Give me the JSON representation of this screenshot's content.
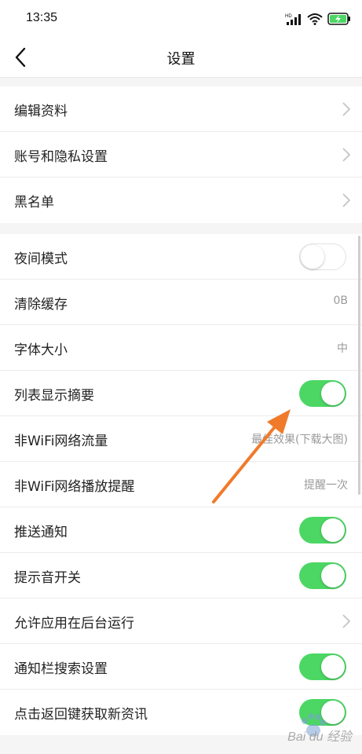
{
  "status": {
    "time": "13:35",
    "network_label": "HD"
  },
  "nav": {
    "title": "设置"
  },
  "groups": [
    {
      "rows": [
        {
          "label": "编辑资料",
          "accessory": "chevron"
        },
        {
          "label": "账号和隐私设置",
          "accessory": "chevron"
        },
        {
          "label": "黑名单",
          "accessory": "chevron"
        }
      ]
    },
    {
      "rows": [
        {
          "label": "夜间模式",
          "accessory": "toggle",
          "on": false
        },
        {
          "label": "清除缓存",
          "accessory": "value",
          "value": "0B"
        },
        {
          "label": "字体大小",
          "accessory": "value",
          "value": "中"
        },
        {
          "label": "列表显示摘要",
          "accessory": "toggle",
          "on": true
        },
        {
          "label": "非WiFi网络流量",
          "accessory": "value",
          "value": "最佳效果(下载大图)"
        },
        {
          "label": "非WiFi网络播放提醒",
          "accessory": "value",
          "value": "提醒一次"
        },
        {
          "label": "推送通知",
          "accessory": "toggle",
          "on": true
        },
        {
          "label": "提示音开关",
          "accessory": "toggle",
          "on": true
        },
        {
          "label": "允许应用在后台运行",
          "accessory": "chevron"
        },
        {
          "label": "通知栏搜索设置",
          "accessory": "toggle",
          "on": true
        },
        {
          "label": "点击返回键获取新资讯",
          "accessory": "toggle",
          "on": true
        }
      ]
    }
  ],
  "colors": {
    "toggle_on": "#4cd764",
    "arrow": "#f07a2a",
    "battery": "#4cd764"
  },
  "icons": {
    "back": "chevron-left-icon",
    "row_chevron": "chevron-right-icon",
    "signal": "signal-icon",
    "wifi": "wifi-icon",
    "battery": "battery-charging-icon"
  },
  "watermark": {
    "text": "Bai du 经验"
  }
}
